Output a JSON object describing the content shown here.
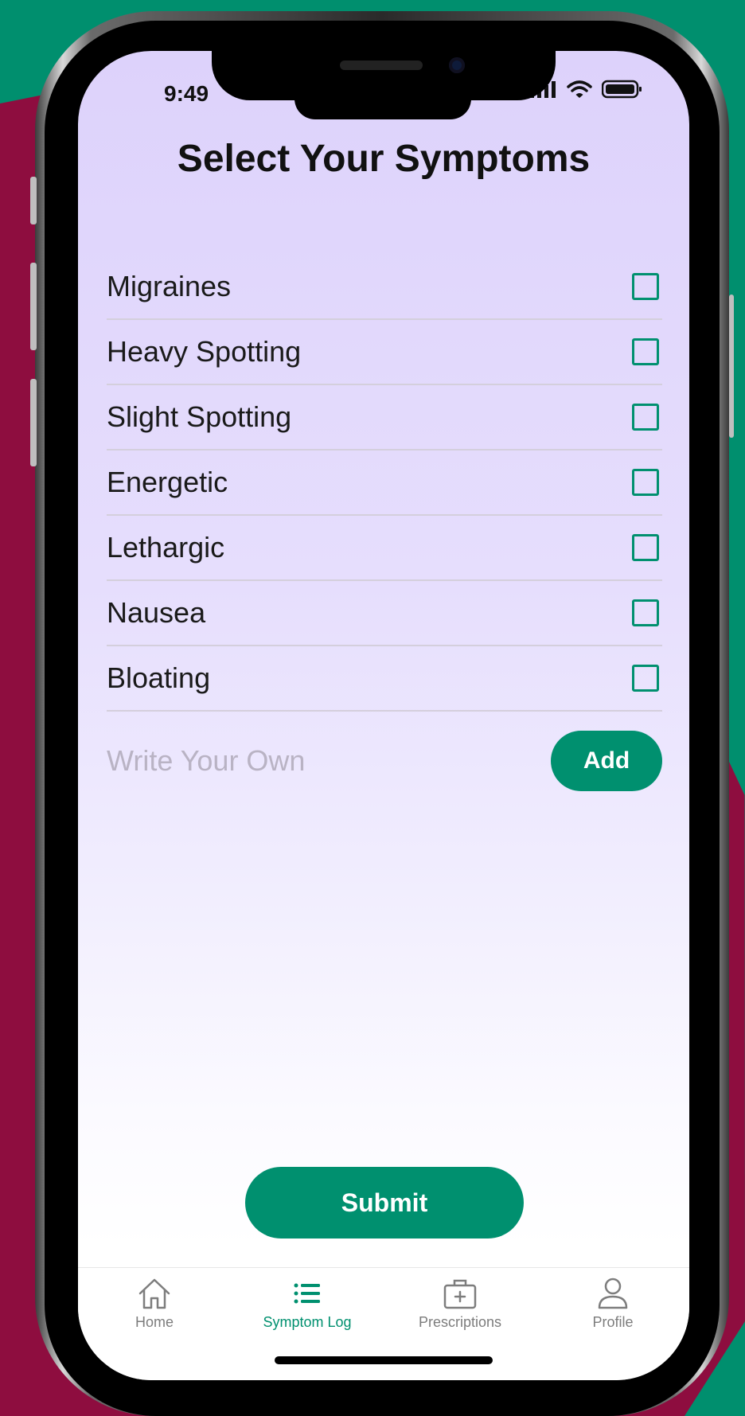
{
  "status_bar": {
    "time": "9:49"
  },
  "page": {
    "title": "Select Your Symptoms"
  },
  "symptoms": [
    {
      "label": "Migraines",
      "checked": false
    },
    {
      "label": "Heavy Spotting",
      "checked": false
    },
    {
      "label": "Slight Spotting",
      "checked": false
    },
    {
      "label": "Energetic",
      "checked": false
    },
    {
      "label": "Lethargic",
      "checked": false
    },
    {
      "label": "Nausea",
      "checked": false
    },
    {
      "label": "Bloating",
      "checked": false
    }
  ],
  "custom_entry": {
    "placeholder": "Write Your Own",
    "value": "",
    "add_label": "Add"
  },
  "submit_label": "Submit",
  "tabs": [
    {
      "label": "Home",
      "icon": "home-icon",
      "active": false
    },
    {
      "label": "Symptom Log",
      "icon": "list-icon",
      "active": true
    },
    {
      "label": "Prescriptions",
      "icon": "medical-kit-icon",
      "active": false
    },
    {
      "label": "Profile",
      "icon": "person-icon",
      "active": false
    }
  ],
  "colors": {
    "accent": "#00906f",
    "background_green": "#008f6e",
    "background_crimson": "#8e0d3f",
    "screen_top": "#ddd2fb"
  }
}
